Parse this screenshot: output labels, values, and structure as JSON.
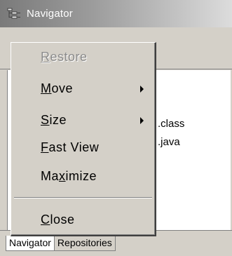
{
  "window": {
    "title": "Navigator"
  },
  "files": [
    ".class",
    ".java"
  ],
  "tabs": [
    "Navigator",
    "Repositories"
  ],
  "menu": {
    "items": [
      {
        "pre": "",
        "u": "R",
        "post": "estore",
        "disabled": true,
        "submenu": false
      },
      {
        "pre": "",
        "u": "M",
        "post": "ove",
        "disabled": false,
        "submenu": true
      },
      {
        "pre": "",
        "u": "S",
        "post": "ize",
        "disabled": false,
        "submenu": true
      },
      {
        "pre": "",
        "u": "F",
        "post": "ast View",
        "disabled": false,
        "submenu": false
      },
      {
        "pre": "Ma",
        "u": "x",
        "post": "imize",
        "disabled": false,
        "submenu": false
      },
      {
        "pre": "",
        "u": "C",
        "post": "lose",
        "disabled": false,
        "submenu": false
      }
    ]
  }
}
